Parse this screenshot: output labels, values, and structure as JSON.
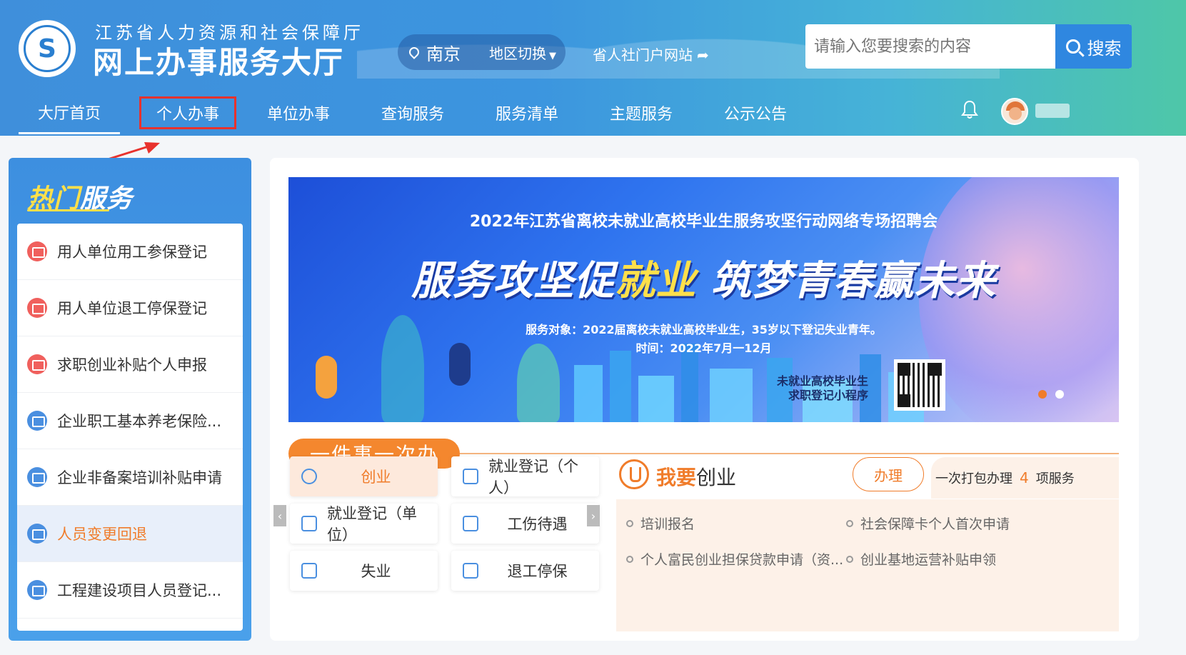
{
  "header": {
    "org_name": "江苏省人力资源和社会保障厅",
    "hall_name": "网上办事服务大厅",
    "region": {
      "city": "南京",
      "switch_label": "地区切换"
    },
    "portal_link": "省人社门户网站",
    "search": {
      "placeholder": "请输入您要搜索的内容",
      "button_label": "搜索"
    }
  },
  "nav": {
    "items": [
      {
        "label": "大厅首页"
      },
      {
        "label": "个人办事"
      },
      {
        "label": "单位办事"
      },
      {
        "label": "查询服务"
      },
      {
        "label": "服务清单"
      },
      {
        "label": "主题服务"
      },
      {
        "label": "公示公告"
      }
    ],
    "active_index": 0,
    "highlighted_index": 1
  },
  "hot_services": {
    "title_part1": "热门",
    "title_part2": "服务",
    "items": [
      {
        "label": "用人单位用工参保登记",
        "icon": "card-icon",
        "color": "red"
      },
      {
        "label": "用人单位退工停保登记",
        "icon": "card-icon",
        "color": "red"
      },
      {
        "label": "求职创业补贴个人申报",
        "icon": "truck-icon",
        "color": "red"
      },
      {
        "label": "企业职工基本养老保险...",
        "icon": "doc-icon",
        "color": "blue"
      },
      {
        "label": "企业非备案培训补贴申请",
        "icon": "doc-icon",
        "color": "blue"
      },
      {
        "label": "人员变更回退",
        "icon": "doc-icon",
        "color": "blue",
        "selected": true
      },
      {
        "label": "工程建设项目人员登记...",
        "icon": "doc-icon",
        "color": "blue"
      }
    ]
  },
  "banner": {
    "subtitle": "2022年江苏省离校未就业高校毕业生服务攻坚行动网络专场招聘会",
    "headline_a": "服务攻坚促",
    "headline_b": "就业",
    "headline_c": " 筑梦青春赢未来",
    "target": "服务对象：2022届离校未就业高校毕业生，35岁以下登记失业青年。",
    "time": "时间：2022年7月一12月",
    "qr_label_line1": "未就业高校毕业生",
    "qr_label_line2": "求职登记小程序"
  },
  "one_thing": {
    "title": "一件事一次办",
    "tiles": [
      {
        "label": "创业",
        "selected": true
      },
      {
        "label": "就业登记（个人）"
      },
      {
        "label": "就业登记（单位）"
      },
      {
        "label": "工伤待遇"
      },
      {
        "label": "失业"
      },
      {
        "label": "退工停保"
      }
    ],
    "detail": {
      "title_prefix": "我要",
      "title_suffix": "创业",
      "handle_button": "办理",
      "pack_prefix": "一次打包办理",
      "pack_count": "4",
      "pack_suffix": "项服务",
      "services": [
        "培训报名",
        "社会保障卡个人首次申请",
        "个人富民创业担保贷款申请（资...",
        "创业基地运营补贴申领"
      ]
    }
  },
  "colors": {
    "header_blue": "#3c95df",
    "header_green": "#4ec7a8",
    "accent_orange": "#f07c2a",
    "annotation_red": "#e8322d"
  }
}
